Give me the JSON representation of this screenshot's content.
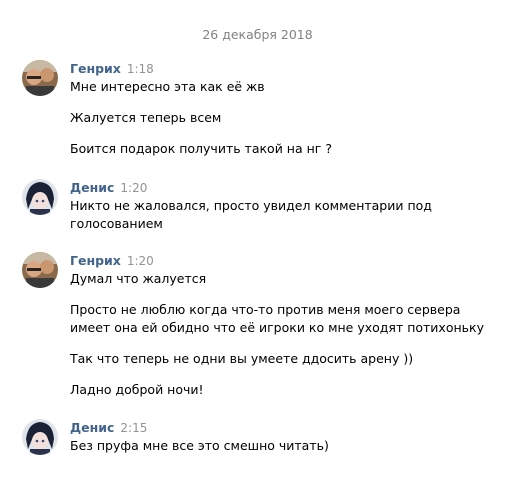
{
  "date_separator": "26 декабря 2018",
  "messages": [
    {
      "author": "Генрих",
      "time": "1:18",
      "avatar": "genrikh-photo",
      "lines": [
        "Мне интересно эта как её жв",
        "Жалуется теперь всем",
        "Боится подарок получить такой на нг ?"
      ]
    },
    {
      "author": "Денис",
      "time": "1:20",
      "avatar": "denis-anime",
      "lines": [
        "Никто не жаловался, просто увидел комментарии под",
        "голосованием"
      ]
    },
    {
      "author": "Генрих",
      "time": "1:20",
      "avatar": "genrikh-photo",
      "lines": [
        "Думал что жалуется",
        "Просто не люблю когда что-то против меня моего сервера",
        "имеет она ей обидно что её игроки ко мне уходят потихоньку",
        "Так что теперь не одни вы умеете ддосить арену ))",
        "Ладно доброй ночи!"
      ]
    },
    {
      "author": "Денис",
      "time": "2:15",
      "avatar": "denis-anime",
      "lines": [
        "Без пруфа мне все это смешно читать)"
      ]
    }
  ],
  "colors": {
    "author_name": "#42648b",
    "timestamp": "#939393",
    "date_separator": "#828282",
    "background": "#ffffff"
  }
}
